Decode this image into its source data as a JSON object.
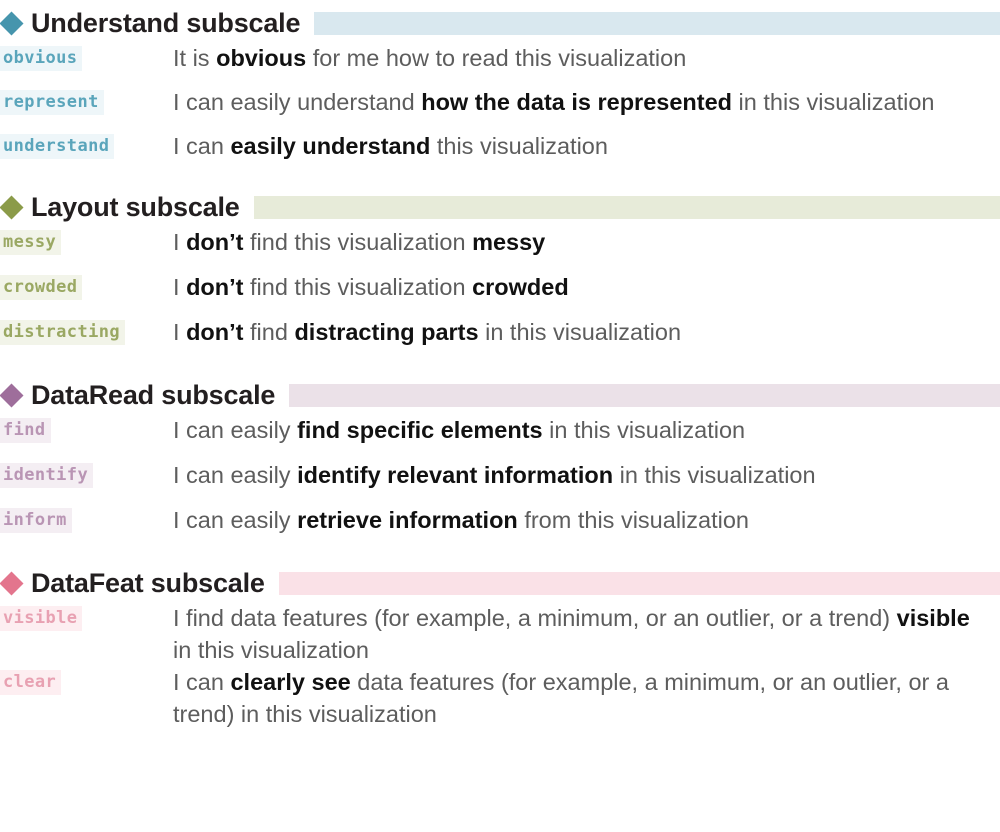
{
  "figure": {
    "kind": "questionnaire-subscale-list",
    "title_suffix": "subscale"
  },
  "sections": [
    {
      "id": "understand",
      "title": "Understand subscale",
      "marker_icon": "diamond-icon",
      "colors": {
        "marker": "#4695ad",
        "header_bar": "#d9e8ef",
        "chip_text": "#5aa5bb",
        "chip_bg": "#eef6f9"
      },
      "items": [
        {
          "code": "obvious",
          "parts": [
            {
              "text": "It is ",
              "bold": false
            },
            {
              "text": "obvious",
              "bold": true
            },
            {
              "text": " for me how to read this visualization",
              "bold": false
            }
          ]
        },
        {
          "code": "represent",
          "parts": [
            {
              "text": "I can easily understand ",
              "bold": false
            },
            {
              "text": "how the data is represented",
              "bold": true
            },
            {
              "text": " in this visualization",
              "bold": false
            }
          ]
        },
        {
          "code": "understand",
          "parts": [
            {
              "text": "I can ",
              "bold": false
            },
            {
              "text": "easily understand",
              "bold": true
            },
            {
              "text": " this visualization",
              "bold": false
            }
          ]
        }
      ]
    },
    {
      "id": "layout",
      "title": "Layout subscale",
      "marker_icon": "diamond-icon",
      "colors": {
        "marker": "#8b9b49",
        "header_bar": "#e7ebd9",
        "chip_text": "#9aa863",
        "chip_bg": "#f2f4e9"
      },
      "items": [
        {
          "code": "messy",
          "parts": [
            {
              "text": "I ",
              "bold": false
            },
            {
              "text": "don’t",
              "bold": true
            },
            {
              "text": " find this visualization ",
              "bold": false
            },
            {
              "text": "messy",
              "bold": true
            }
          ]
        },
        {
          "code": "crowded",
          "parts": [
            {
              "text": "I ",
              "bold": false
            },
            {
              "text": "don’t",
              "bold": true
            },
            {
              "text": " find this visualization ",
              "bold": false
            },
            {
              "text": "crowded",
              "bold": true
            }
          ]
        },
        {
          "code": "distracting",
          "parts": [
            {
              "text": "I ",
              "bold": false
            },
            {
              "text": "don’t",
              "bold": true
            },
            {
              "text": " find ",
              "bold": false
            },
            {
              "text": "distracting parts",
              "bold": true
            },
            {
              "text": " in this visualization",
              "bold": false
            }
          ]
        }
      ]
    },
    {
      "id": "dataread",
      "title": "DataRead subscale",
      "marker_icon": "diamond-icon",
      "colors": {
        "marker": "#9e6e9b",
        "header_bar": "#ebe1e8",
        "chip_text": "#b995b4",
        "chip_bg": "#f4eef3"
      },
      "items": [
        {
          "code": "find",
          "parts": [
            {
              "text": "I can easily ",
              "bold": false
            },
            {
              "text": "find specific elements",
              "bold": true
            },
            {
              "text": " in this visualization",
              "bold": false
            }
          ]
        },
        {
          "code": "identify",
          "parts": [
            {
              "text": "I can easily ",
              "bold": false
            },
            {
              "text": "identify relevant information",
              "bold": true
            },
            {
              "text": " in this visualization",
              "bold": false
            }
          ]
        },
        {
          "code": "inform",
          "parts": [
            {
              "text": "I can easily ",
              "bold": false
            },
            {
              "text": "retrieve information",
              "bold": true
            },
            {
              "text": " from this visualization",
              "bold": false
            }
          ]
        }
      ]
    },
    {
      "id": "datafeat",
      "title": "DataFeat subscale",
      "marker_icon": "diamond-icon",
      "colors": {
        "marker": "#e3758d",
        "header_bar": "#fae1e7",
        "chip_text": "#e8a1b2",
        "chip_bg": "#fdeef1"
      },
      "items": [
        {
          "code": "visible",
          "parts": [
            {
              "text": "I find data features (for example, a minimum, or an outlier, or a trend) ",
              "bold": false
            },
            {
              "text": "visible",
              "bold": true
            },
            {
              "text": " in this visualization",
              "bold": false
            }
          ]
        },
        {
          "code": "clear",
          "parts": [
            {
              "text": "I can ",
              "bold": false
            },
            {
              "text": "clearly see",
              "bold": true
            },
            {
              "text": " data features (for example, a minimum, or an outlier, or a trend) in this visualization",
              "bold": false
            }
          ]
        }
      ]
    }
  ]
}
